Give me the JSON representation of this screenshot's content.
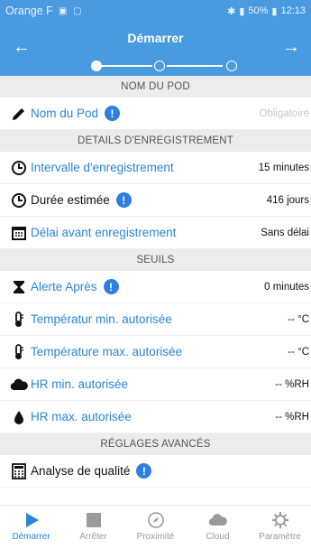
{
  "status_bar": {
    "carrier": "Orange F",
    "battery": "50%",
    "time": "12:13"
  },
  "header": {
    "title": "Démarrer",
    "back_icon": "arrow-left",
    "next_icon": "arrow-right",
    "steps_total": 3,
    "current_step": 1
  },
  "sections": {
    "pod_name": "NOM DU POD",
    "recording": "DETAILS D'ENREGISTREMENT",
    "thresholds": "SEUILS",
    "advanced": "RÉGLAGES AVANCÉS"
  },
  "rows": {
    "pod_name": {
      "label": "Nom du Pod",
      "value": "Obligatoire",
      "icon": "pencil-icon"
    },
    "interval": {
      "label": "Intervalle d'enregistrement",
      "value": "15 minutes",
      "icon": "clock-icon"
    },
    "duration": {
      "label": "Durée estimée",
      "value": "416 jours",
      "icon": "clock-icon"
    },
    "delay": {
      "label": "Délai avant enregistrement",
      "value": "Sans délai",
      "icon": "calendar-icon"
    },
    "alert_after": {
      "label": "Alerte Après",
      "value": "0 minutes",
      "icon": "hourglass-icon"
    },
    "temp_min": {
      "label": "Températur min. autorisée",
      "value": "-- °C",
      "icon": "thermometer-icon"
    },
    "temp_max": {
      "label": "Température max. autorisée",
      "value": "-- °C",
      "icon": "thermometer-icon"
    },
    "hr_min": {
      "label": "HR min. autorisée",
      "value": "-- %RH",
      "icon": "cloud-icon"
    },
    "hr_max": {
      "label": "HR max. autorisée",
      "value": "-- %RH",
      "icon": "drop-icon"
    },
    "quality": {
      "label": "Analyse de qualité",
      "icon": "calculator-icon"
    }
  },
  "nav": {
    "items": [
      {
        "label": "Démarrer",
        "icon": "play-icon"
      },
      {
        "label": "Arrêter",
        "icon": "stop-icon"
      },
      {
        "label": "Proximité",
        "icon": "compass-icon"
      },
      {
        "label": "Cloud",
        "icon": "cloud-icon"
      },
      {
        "label": "Paramètre",
        "icon": "gear-icon"
      }
    ]
  },
  "colors": {
    "header": "#4a9ae0",
    "accent_blue": "#2a85d6",
    "info_blue": "#2f7fe0",
    "section_bg": "#ececec"
  }
}
